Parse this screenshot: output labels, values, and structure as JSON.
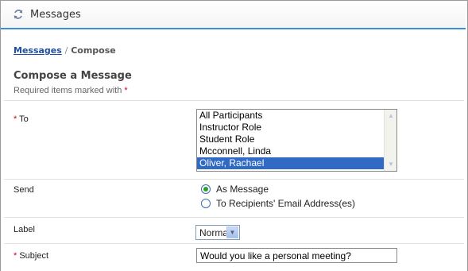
{
  "window": {
    "title": "Messages",
    "icon": "refresh-arrows-icon"
  },
  "breadcrumb": {
    "parent": "Messages",
    "separator": "/",
    "current": "Compose"
  },
  "form": {
    "heading": "Compose a Message",
    "required_note": "Required items marked with",
    "required_marker": "*",
    "to": {
      "label": "To",
      "options": [
        "All Participants",
        "Instructor Role",
        "Student Role",
        "Mcconnell, Linda",
        "Oliver, Rachael"
      ],
      "selected": "Oliver, Rachael"
    },
    "send": {
      "label": "Send",
      "options": [
        "As Message",
        "To Recipients' Email Address(es)"
      ],
      "selected": "As Message"
    },
    "label_field": {
      "label": "Label",
      "value": "Normal"
    },
    "subject": {
      "label": "Subject",
      "value": "Would you like a personal meeting?"
    }
  },
  "colors": {
    "accent": "#3b8fd6",
    "link": "#1f4fa3",
    "required": "#d0021b",
    "selection": "#316ac5"
  }
}
